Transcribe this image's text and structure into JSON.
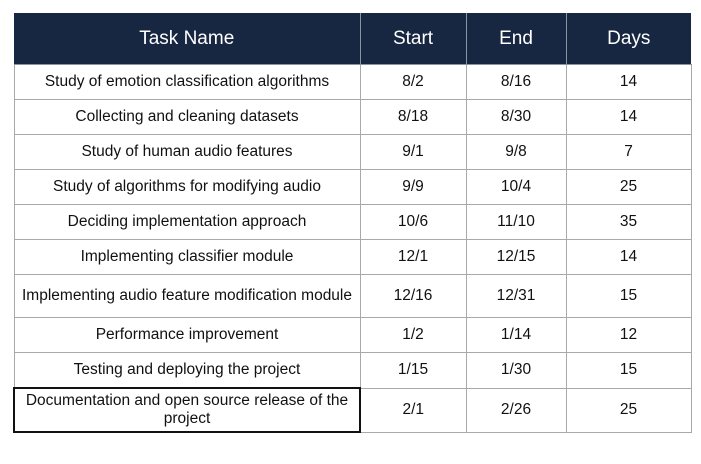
{
  "table": {
    "headers": {
      "task": "Task Name",
      "start": "Start",
      "end": "End",
      "days": "Days"
    },
    "rows": [
      {
        "task": "Study of emotion classification algorithms",
        "start": "8/2",
        "end": "8/16",
        "days": "14"
      },
      {
        "task": "Collecting and cleaning datasets",
        "start": "8/18",
        "end": "8/30",
        "days": "14"
      },
      {
        "task": "Study of human audio features",
        "start": "9/1",
        "end": "9/8",
        "days": "7"
      },
      {
        "task": "Study of algorithms for modifying audio",
        "start": "9/9",
        "end": "10/4",
        "days": "25"
      },
      {
        "task": "Deciding implementation approach",
        "start": "10/6",
        "end": "11/10",
        "days": "35"
      },
      {
        "task": "Implementing classifier module",
        "start": "12/1",
        "end": "12/15",
        "days": "14"
      },
      {
        "task": "Implementing audio feature modification module",
        "start": "12/16",
        "end": "12/31",
        "days": "15"
      },
      {
        "task": "Performance improvement",
        "start": "1/2",
        "end": "1/14",
        "days": "12"
      },
      {
        "task": "Testing and deploying the project",
        "start": "1/15",
        "end": "1/30",
        "days": "15"
      },
      {
        "task": "Documentation and open source release of the project",
        "start": "2/1",
        "end": "2/26",
        "days": "25"
      }
    ]
  }
}
